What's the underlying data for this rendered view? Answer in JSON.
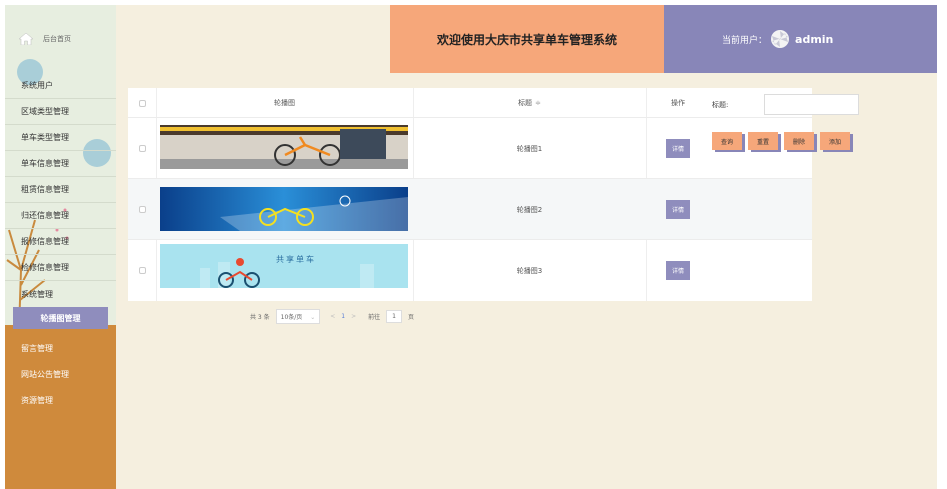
{
  "sidebar": {
    "home_label": "后台首页",
    "menu": [
      "系统用户",
      "区域类型管理",
      "单车类型管理",
      "单车信息管理",
      "租赁信息管理",
      "归还信息管理",
      "报修信息管理",
      "检修信息管理",
      "系统管理",
      "轮播图管理",
      "留言管理",
      "网站公告管理",
      "资源管理"
    ],
    "active_item": "轮播图管理"
  },
  "header": {
    "title": "欢迎使用大庆市共享单车管理系统",
    "user_label": "当前用户：",
    "username": "admin"
  },
  "table": {
    "columns": {
      "image": "轮播图",
      "title": "标题",
      "sort_icon": "≑",
      "action": "操作"
    },
    "rows": [
      {
        "title": "轮播图1",
        "action": "详情"
      },
      {
        "title": "轮播图2",
        "action": "详情"
      },
      {
        "title": "轮播图3",
        "action": "详情"
      }
    ],
    "banner3_text": "共享单车"
  },
  "pagination": {
    "total": "共 3 条",
    "page_size": "10条/页",
    "prev": "<",
    "current": "1",
    "next": ">",
    "goto_label": "前往",
    "goto_value": "1",
    "page_unit": "页"
  },
  "search": {
    "label": "标题:",
    "placeholder": "",
    "buttons": [
      "查询",
      "重置",
      "删除",
      "添加"
    ]
  },
  "colors": {
    "sidebar_bg": "#e7eee0",
    "sidebar_bottom": "#cf8a3c",
    "accent_purple": "#8f8dbd",
    "accent_orange": "#f6a77a",
    "main_bg": "#f5efdf"
  }
}
